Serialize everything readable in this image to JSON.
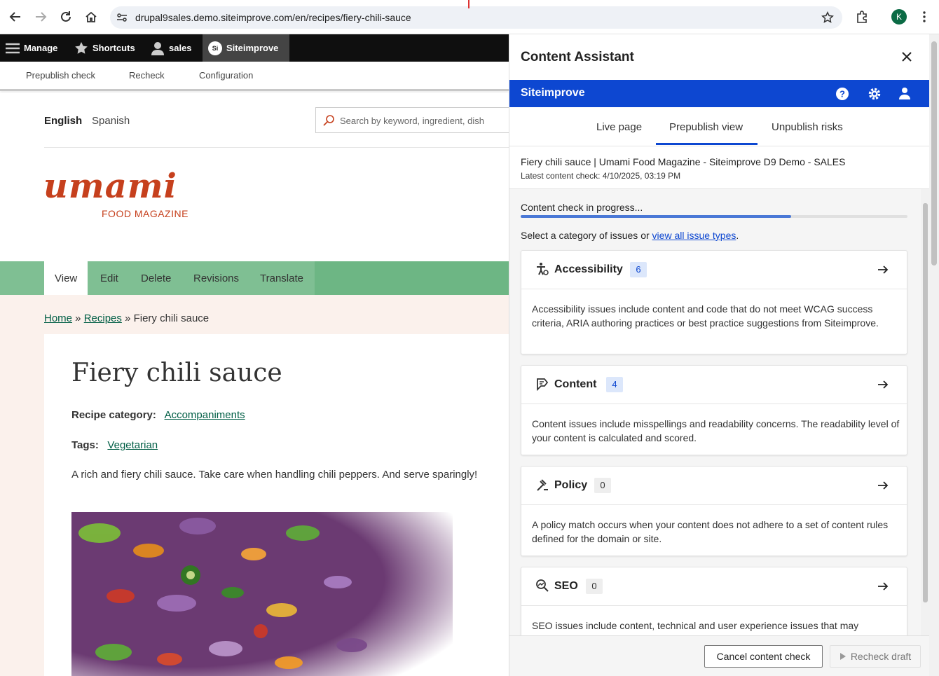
{
  "browser": {
    "url": "drupal9sales.demo.siteimprove.com/en/recipes/fiery-chili-sauce",
    "profile_initial": "K"
  },
  "toolbar": {
    "manage": "Manage",
    "shortcuts": "Shortcuts",
    "user": "sales",
    "siteimprove": "Siteimprove",
    "si_initials": "Si",
    "sub": [
      "Prepublish check",
      "Recheck",
      "Configuration"
    ]
  },
  "site": {
    "lang_en": "English",
    "lang_es": "Spanish",
    "search_placeholder": "Search by keyword, ingredient, dish",
    "logo": "umami",
    "logo_sub": "FOOD MAGAZINE",
    "tabs": [
      "View",
      "Edit",
      "Delete",
      "Revisions",
      "Translate"
    ],
    "breadcrumb": {
      "home": "Home",
      "sep1": " » ",
      "recipes": "Recipes",
      "sep2": " » ",
      "current": "Fiery chili sauce"
    },
    "title": "Fiery chili sauce",
    "category_label": "Recipe category:",
    "category_value": "Accompaniments",
    "tags_label": "Tags:",
    "tags_value": "Vegetarian",
    "description": "A rich and fiery chili sauce. Take care when handling chili peppers. And serve sparingly!"
  },
  "panel": {
    "title": "Content Assistant",
    "brand": "Siteimprove",
    "tabs": [
      "Live page",
      "Prepublish view",
      "Unpublish risks"
    ],
    "active_tab": "Prepublish view",
    "page_name": "Fiery chili sauce | Umami Food Magazine - Siteimprove D9 Demo - SALES",
    "latest_check": "Latest content check: 4/10/2025, 03:19 PM",
    "progress_label": "Content check in progress...",
    "progress_fraction": 0.7,
    "select_prefix": "Select a category of issues or ",
    "select_link": "view all issue types",
    "select_suffix": ".",
    "categories": [
      {
        "name": "Accessibility",
        "count": "6",
        "icon": "accessibility-icon",
        "desc": "Accessibility issues include content and code that do not meet WCAG success criteria, ARIA authoring practices or best practice suggestions from Siteimprove."
      },
      {
        "name": "Content",
        "count": "4",
        "icon": "content-icon",
        "desc": "Content issues include misspellings and readability concerns. The readability level of your content is calculated and scored."
      },
      {
        "name": "Policy",
        "count": "0",
        "icon": "policy-icon",
        "desc": "A policy match occurs when your content does not adhere to a set of content rules defined for the domain or site."
      },
      {
        "name": "SEO",
        "count": "0",
        "icon": "seo-icon",
        "desc": "SEO issues include content, technical and user experience issues that may"
      }
    ],
    "cancel_button": "Cancel content check",
    "recheck_button": "Recheck draft"
  }
}
